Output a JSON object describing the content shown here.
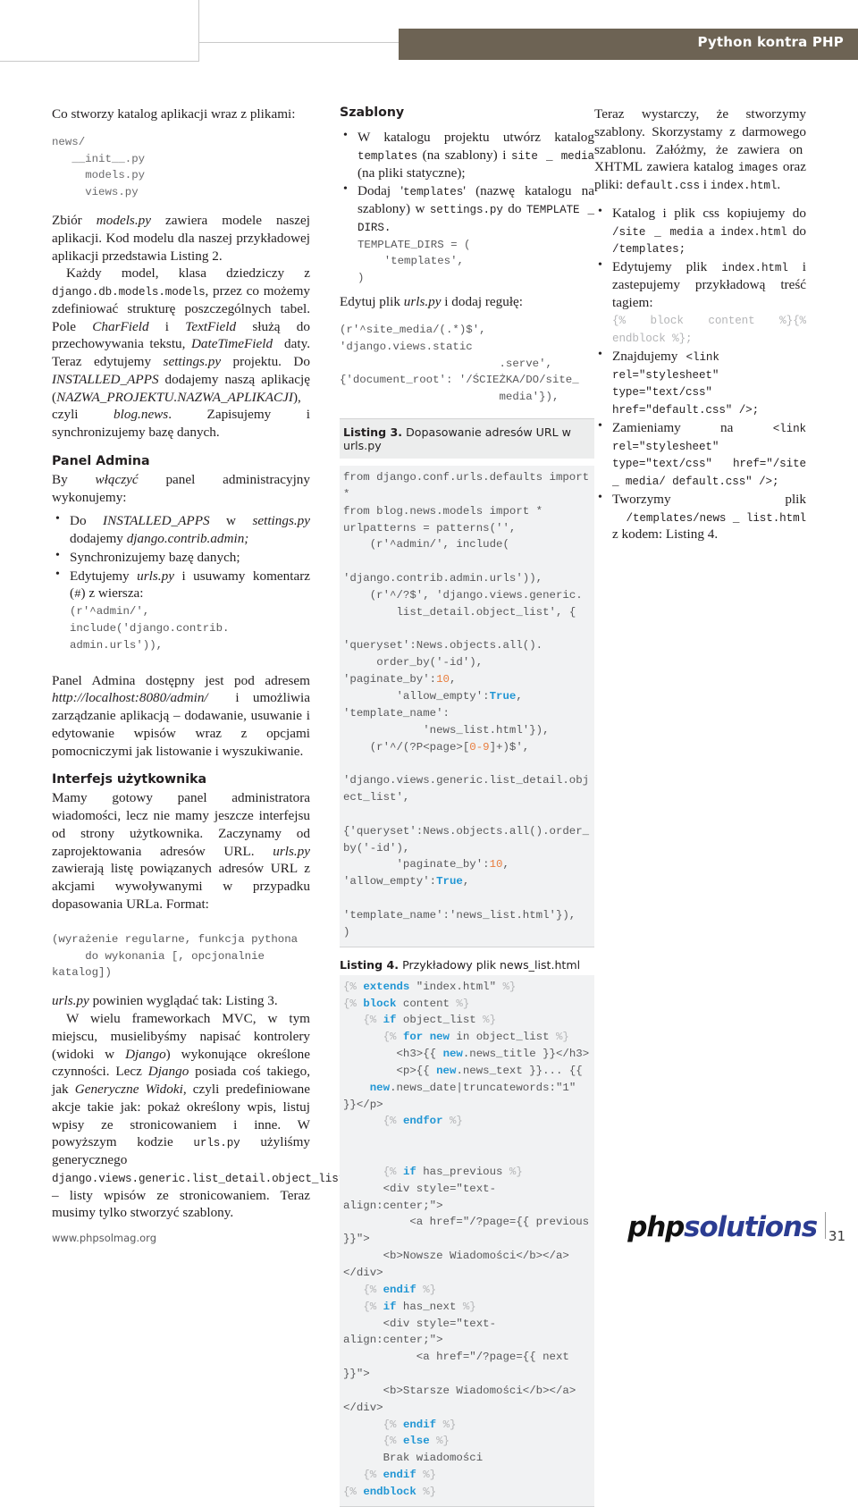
{
  "header": {
    "title": "Python kontra PHP"
  },
  "footer": {
    "url": "www.phpsolmag.org",
    "logo_part1": "php",
    "logo_part2": "solutions",
    "page_number": "31"
  },
  "column_left": {
    "intro": "Co stworzy katalog aplikacji wraz z plikami:",
    "tree_code": "news/\n   __init__.py\n     models.py\n     views.py",
    "para_models": "Zbiór models.py zawiera modele naszej aplikacji. Kod modelu dla naszej przykładowej aplikacji przedstawia Listing 2.",
    "para_each_model": "Każdy model, klasa dziedziczy z django.db.models.models, przez co możemy zdefiniować strukturę poszczególnych tabel. Pole CharField i TextField służą do przechowywania tekstu, DateTimeField daty. Teraz edytujemy settings.py projektu. Do INSTALLED_APPS dodajemy naszą aplikację (NAZWA_PROJEKTU.NAZWA_APLIKACJI), czyli blog.news. Zapisujemy i synchronizujemy bazę danych.",
    "heading_admin": "Panel Admina",
    "para_admin_intro": "By włączyć panel administracyjny wykonujemy:",
    "admin_bullets": [
      "Do INSTALLED_APPS w settings.py dodajemy django.contrib.admin;",
      "Synchronizujemy bazę danych;",
      "Edytujemy urls.py i usuwamy komentarz (#) z wiersza:"
    ],
    "admin_code": "(r'^admin/', include('django.contrib.\nadmin.urls')),",
    "para_admin_url": "Panel Admina dostępny jest pod adresem http://localhost:8080/admin/ i umożliwia zarządzanie aplikacją – dodawanie, usuwanie i edytowanie wpisów wraz z opcjami pomocniczymi jak listowanie i wyszukiwanie.",
    "heading_ui": "Interfejs użytkownika",
    "para_ui": "Mamy gotowy panel administratora wiadomości, lecz nie mamy jeszcze interfejsu od strony użytkownika. Zaczynamy od zaprojektowania adresów URL. urls.py zawierają listę powiązanych adresów URL z akcjami wywoływanymi w przypadku dopasowania URLa. Format:",
    "format_code": "(wyrażenie regularne, funkcja pythona\n     do wykonania [, opcjonalnie katalog])",
    "para_urls_listing": "urls.py powinien wyglądać tak: Listing 3.",
    "para_generic": "W wielu frameworkach MVC, w tym miejscu, musielibyśmy napisać kontrolery (widoki w Django) wykonujące określone czynności. Lecz Django posiada coś takiego, jak Generyczne Widoki, czyli predefiniowane akcje takie jak: pokaż określony wpis, listuj wpisy ze stronicowaniem i inne. W powyższym kodzie urls.py użyliśmy generycznego django.views.generic.list_detail.object_list – listy wpisów ze stronicowaniem. Teraz musimy tylko stworzyć szablony."
  },
  "column_middle": {
    "heading_templates": "Szablony",
    "bullets": [
      "W katalogu projektu utwórz katalog templates (na szablony) i site _ media (na pliki statyczne);",
      "Dodaj 'templates' (nazwę katalogu na szablony) w settings.py do TEMPLATE _ DIRS."
    ],
    "template_dirs_code": "TEMPLATE_DIRS = (\n    'templates',\n)",
    "para_edit_urls": "Edytuj plik urls.py i dodaj regułę:",
    "site_media_code": "(r'^site_media/(.*)$', 'django.views.static\n                        .serve',\n{'document_root': '/ŚCIEŻKA/DO/site_\n                        media'}),",
    "listing3_label": "Listing 3.",
    "listing3_caption": "Dopasowanie adresów URL w urls.py",
    "listing3_code": "from django.conf.urls.defaults import *\nfrom blog.news.models import *\nurlpatterns = patterns('',\n    (r'^admin/', include(\n        'django.contrib.admin.urls')),\n    (r'^/?$', 'django.views.generic.\n        list_detail.object_list', {\n        'queryset':News.objects.all().\n     order_by('-id'), 'paginate_by':10,\n        'allow_empty':True, 'template_name':\n            'news_list.html'}),\n    (r'^/(?P<page>[0-9]+)$',\n      'django.views.generic.list_detail.object_list',\n     {'queryset':News.objects.all().order_by('-id'),\n        'paginate_by':10, 'allow_empty':True,\n          'template_name':'news_list.html'}),\n)",
    "listing4_label": "Listing 4.",
    "listing4_caption": "Przykładowy plik news_list.html",
    "listing4_code": "{% extends \"index.html\" %}\n{% block content %}\n   {% if object_list %}\n      {% for new in object_list %}\n        <h3>{{ new.news_title }}</h3>\n        <p>{{ new.news_text }}... {{\n    new.news_date|truncatewords:\"1\" }}</p>\n      {% endfor %}\n\n\n      {% if has_previous %}\n      <div style=\"text-align:center;\">\n          <a href=\"/?page={{ previous }}\">\n      <b>Nowsze Wiadomości</b></a></div>\n   {% endif %}\n   {% if has_next %}\n      <div style=\"text-align:center;\">\n           <a href=\"/?page={{ next }}\">\n      <b>Starsze Wiadomości</b></a></div>\n      {% endif %}\n      {% else %}\n      Brak wiadomości\n   {% endif %}\n{% endblock %}"
  },
  "column_right": {
    "para_intro": "Teraz wystarczy, że stworzymy szablony. Skorzystamy z darmowego szablonu. Załóżmy, że zawiera on  XHTML zawiera katalog images oraz pliki: default.css i index.html.",
    "bullets": [
      "Katalog i plik css kopiujemy do /site _ media a index.html do /templates;",
      "Edytujemy plik index.html i zastepujemy przykładową treść tagiem:",
      "Znajdujemy <link rel=\"stylesheet\" type=\"text/css\" href=\"default.css\" />;",
      "Zamieniamy na <link rel=\"stylesheet\" type=\"text/css\" href=\"/site _ media/ default.css\" />;",
      "Tworzymy plik /templates/news _ list.html z kodem: Listing 4."
    ],
    "block_content_code": "{% block content %}{% endblock %};"
  },
  "colors": {
    "header_bar": "#6d6354",
    "code_text": "#58585a",
    "keyword": "#2196d4",
    "number": "#e87d3e",
    "listing_bg": "#f1f2f3",
    "caption_bg": "#eceded",
    "logo_blue": "#2b3c92"
  }
}
